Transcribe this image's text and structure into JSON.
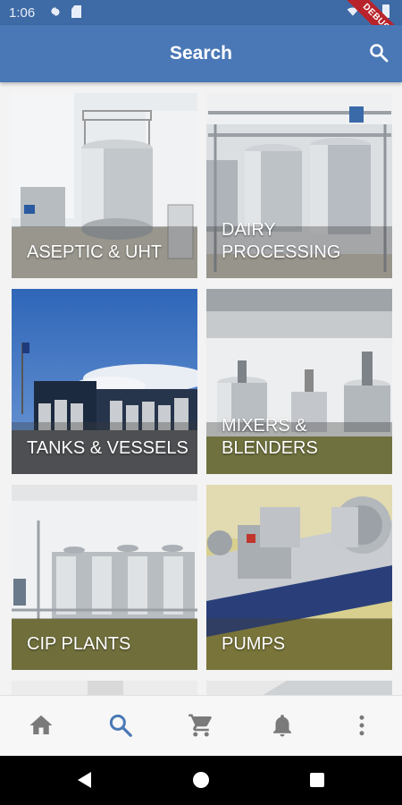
{
  "status_bar": {
    "time": "1:06",
    "debug_banner": "DEBUG"
  },
  "app_bar": {
    "title": "Search"
  },
  "categories": [
    {
      "label": "ASEPTIC & UHT"
    },
    {
      "label": "DAIRY PROCESSING"
    },
    {
      "label": "TANKS & VESSELS"
    },
    {
      "label": "MIXERS & BLENDERS"
    },
    {
      "label": "CIP PLANTS"
    },
    {
      "label": "PUMPS"
    }
  ],
  "bottom_nav": {
    "items": [
      {
        "icon": "home-icon"
      },
      {
        "icon": "search-icon",
        "active": true
      },
      {
        "icon": "cart-icon"
      },
      {
        "icon": "bell-icon"
      },
      {
        "icon": "more-vert-icon"
      }
    ]
  },
  "colors": {
    "app_bar": "#4a78b6",
    "status_bar": "#3e6ba6",
    "active_nav": "#4a78b6",
    "inactive_nav": "#7a7a7a"
  }
}
